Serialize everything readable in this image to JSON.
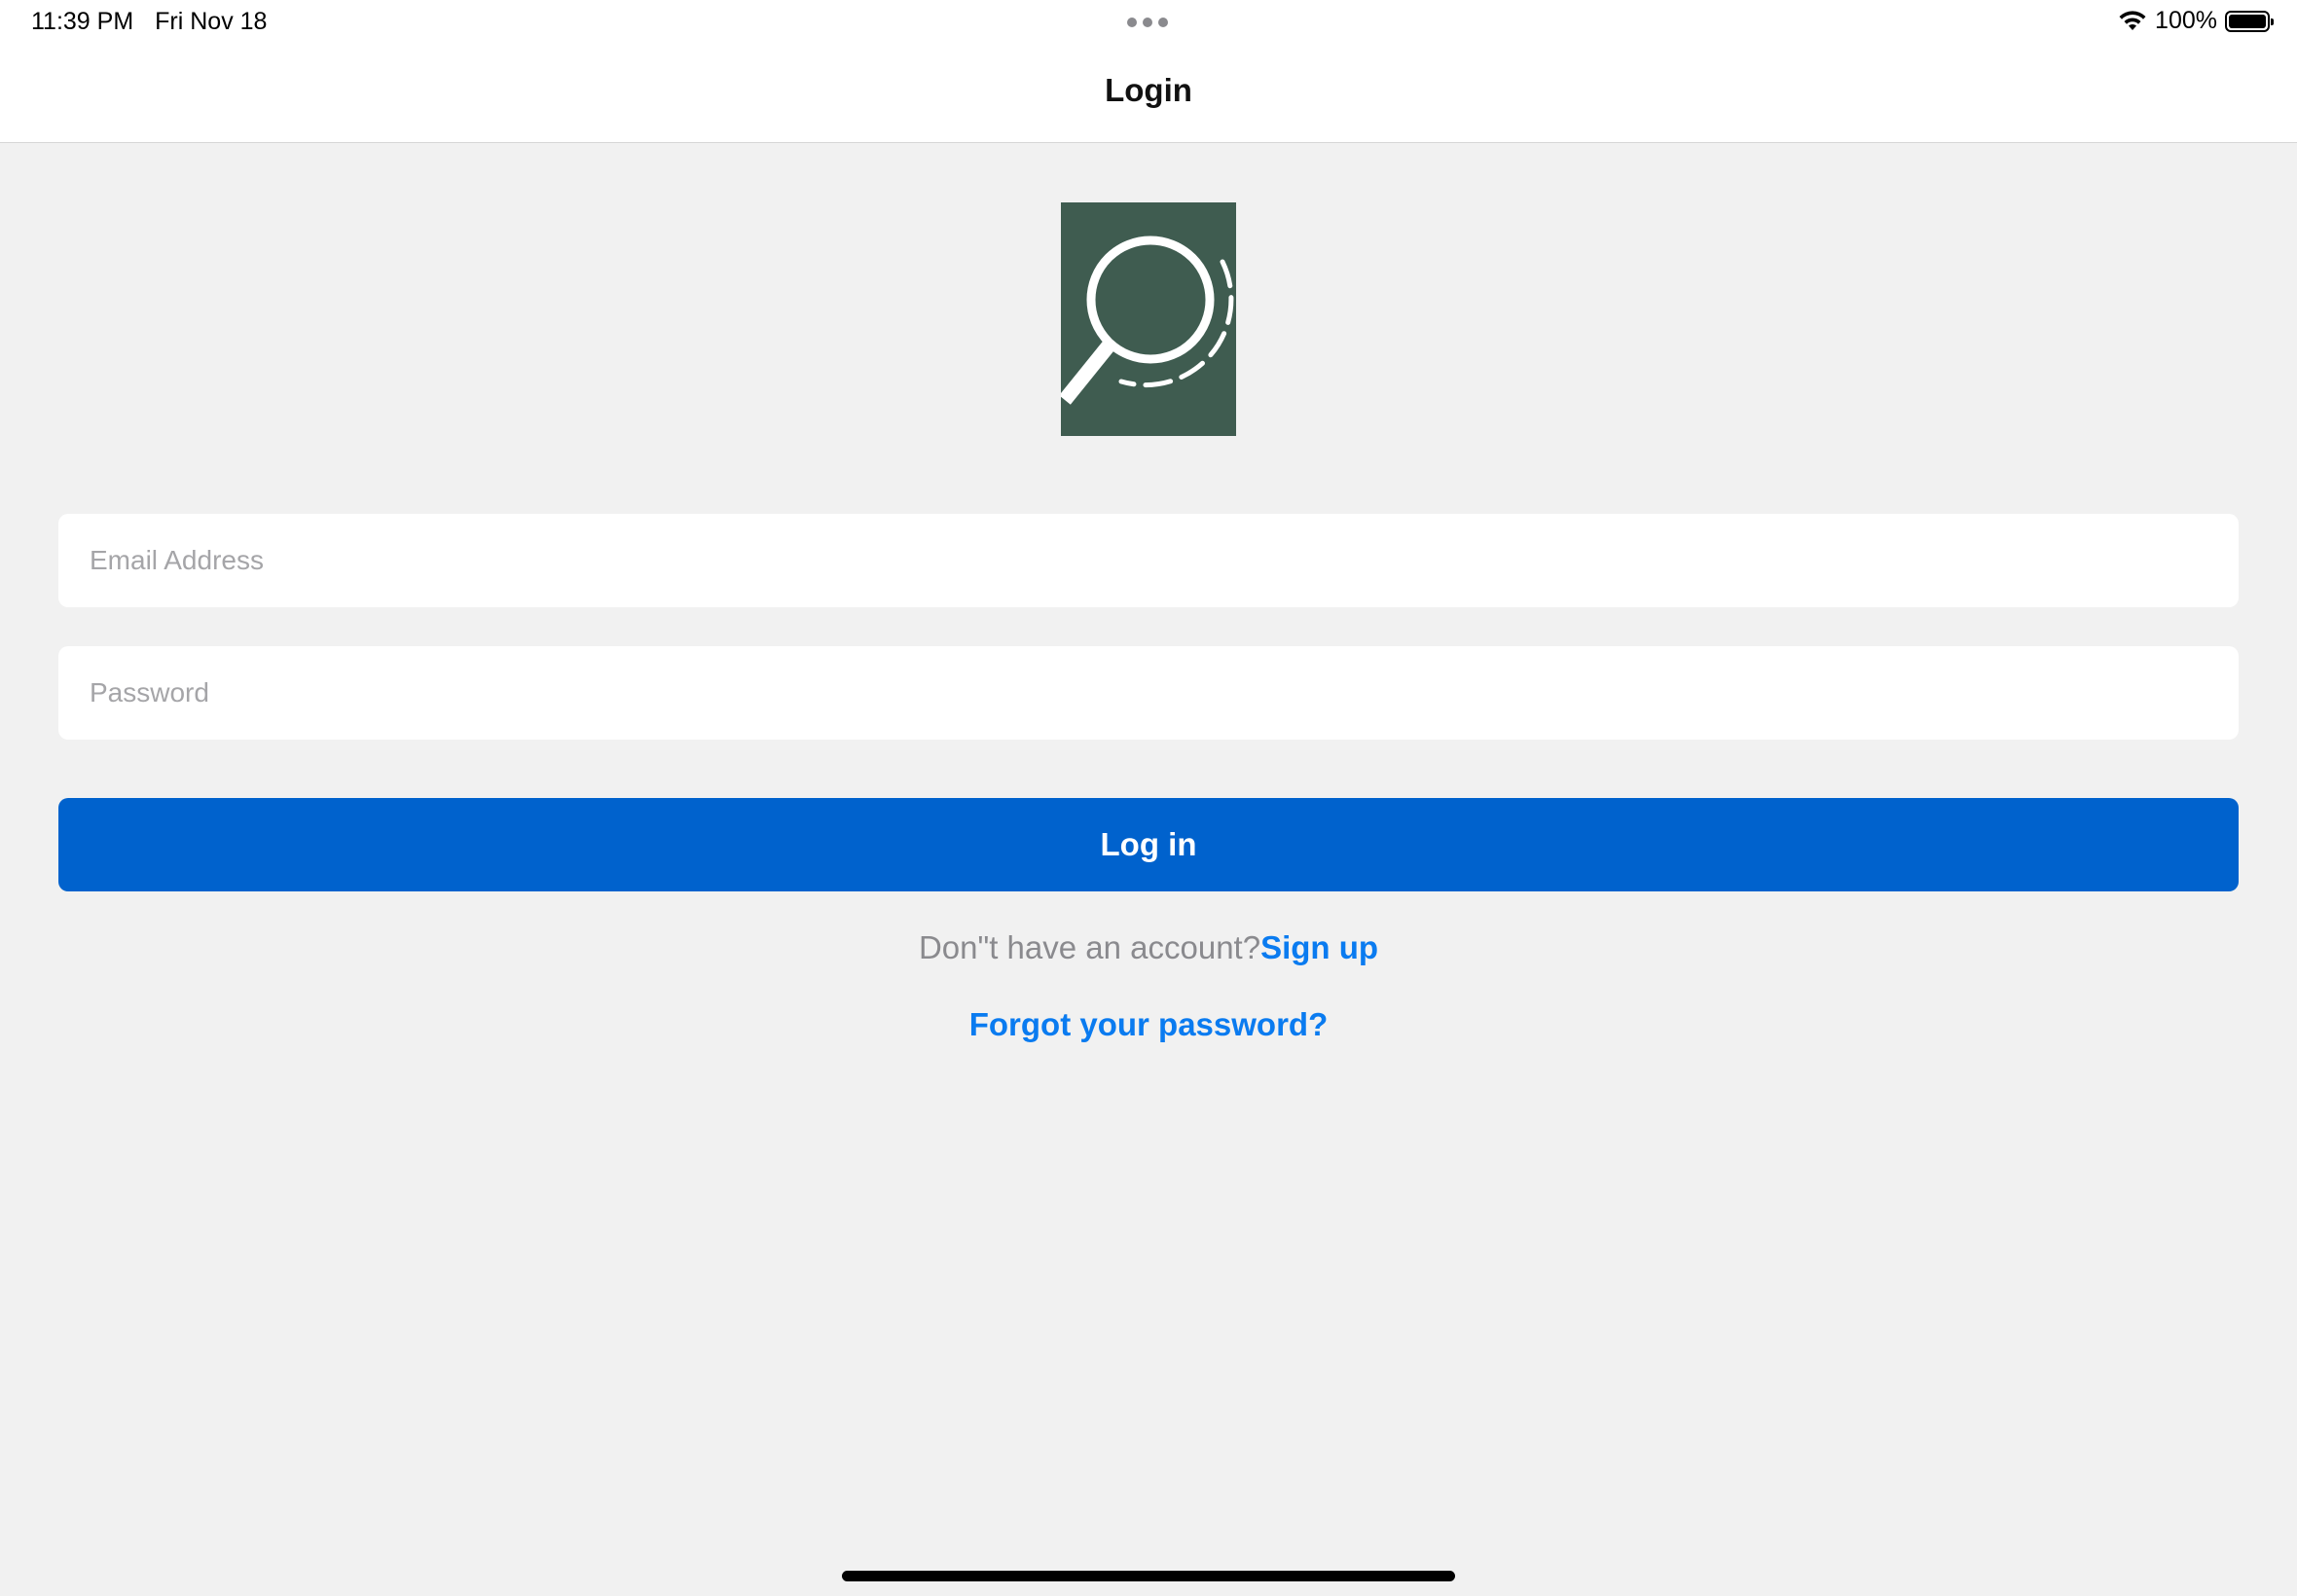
{
  "status_bar": {
    "time": "11:39 PM",
    "date": "Fri Nov 18",
    "battery_percent": "100%",
    "icons": [
      "wifi-icon",
      "battery-icon"
    ]
  },
  "nav": {
    "title": "Login"
  },
  "logo": {
    "icon": "magnifier-logo-icon",
    "background_color": "#3f5c50"
  },
  "form": {
    "email_placeholder": "Email Address",
    "email_value": "",
    "password_placeholder": "Password",
    "password_value": "",
    "login_label": "Log in",
    "login_color": "#0062cd"
  },
  "footer_links": {
    "signup_prompt": "Don\"t have an account?",
    "signup_label": "Sign up",
    "forgot_label": "Forgot your password?",
    "link_color": "#0a7bf0"
  }
}
